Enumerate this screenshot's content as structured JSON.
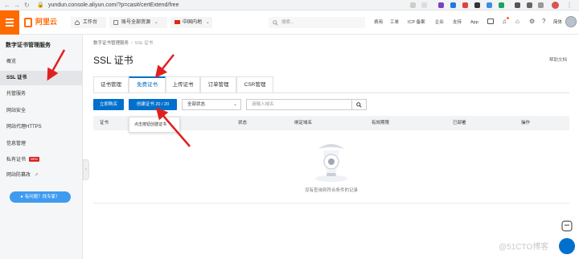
{
  "browser": {
    "url": "yundun.console.aliyun.com/?p=cas#/certExtend/free"
  },
  "header": {
    "logo_text": "阿里云",
    "workbench": "工作台",
    "account_resources": "账号全部资源",
    "region": "中国内地",
    "search_placeholder": "搜索...",
    "links": [
      "费用",
      "工单",
      "ICP 备案",
      "企业",
      "支持",
      "App"
    ],
    "lang": "简体"
  },
  "sidebar": {
    "title": "数字证书管理服务",
    "items": [
      {
        "label": "概览"
      },
      {
        "label": "SSL 证书"
      },
      {
        "label": "托管服务"
      },
      {
        "label": "网站安全"
      },
      {
        "label": "网站代理HTTPS"
      },
      {
        "label": "信息管理"
      },
      {
        "label": "私有证书",
        "badge": "NEW"
      },
      {
        "label": "网站防篡改"
      }
    ],
    "help_button": "有问题？找专家！"
  },
  "main": {
    "breadcrumb": [
      "数字证书管理服务",
      "SSL 证书"
    ],
    "page_title": "SSL 证书",
    "help_doc": "帮助文档",
    "tabs": [
      {
        "label": "证书管理"
      },
      {
        "label": "免费证书",
        "active": true
      },
      {
        "label": "上传证书"
      },
      {
        "label": "订单管理"
      },
      {
        "label": "CSR管理"
      }
    ],
    "buy_button": "立即购买",
    "create_button": "创建证书 20 / 20",
    "status_select": "全部状态",
    "domain_placeholder": "请输入域名",
    "table_columns": [
      "证书",
      "状态",
      "绑定域名",
      "有效期限",
      "已部署",
      "操作"
    ],
    "empty_text": "没有查询到符合条件的记录",
    "tooltip": "点击按钮创建证书"
  },
  "watermark": "@51CTO博客",
  "colors": {
    "brand_orange": "#ff6a00",
    "primary_blue": "#0070cc",
    "arrow_red": "#e02020"
  }
}
